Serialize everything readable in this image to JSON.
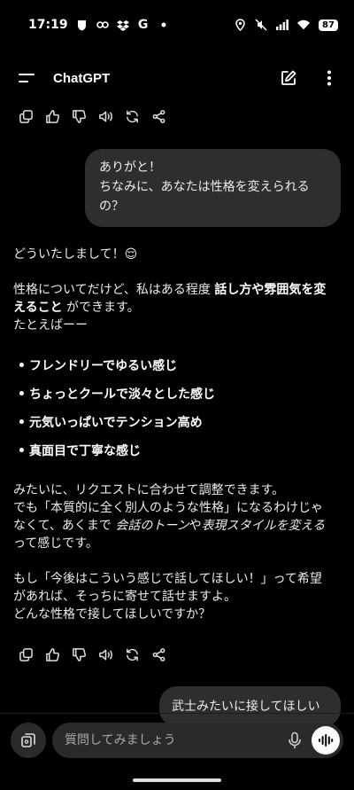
{
  "status_bar": {
    "time": "17:19",
    "battery": "87",
    "icons": [
      "shield-icon",
      "link-icon",
      "dropbox-icon",
      "google-g-icon",
      "dot-icon",
      "location-icon",
      "mute-icon",
      "signal-icon",
      "wifi-icon",
      "battery-icon"
    ],
    "g_label": "G"
  },
  "header": {
    "title": "ChatGPT",
    "icons": [
      "menu-icon",
      "new-chat-icon",
      "more-vert-icon"
    ]
  },
  "action_icons": [
    "copy-icon",
    "thumbs-up-icon",
    "thumbs-down-icon",
    "read-aloud-icon",
    "regenerate-icon",
    "share-icon"
  ],
  "user_message_1": {
    "line1": "ありがと！",
    "line2": "ちなみに、あなたは性格を変えられる",
    "line3": "の？"
  },
  "assistant_message": {
    "greeting": "どういたしまして！😌",
    "p1_pre": "性格についてだけど、私はある程度 ",
    "p1_bold1": "話し方や雰囲気を変",
    "p1_bold2": "えること",
    "p1_post": " ができます。",
    "p1_line3": "たとえばーー",
    "bullets": [
      "フレンドリーでゆるい感じ",
      "ちょっとクールで淡々とした感じ",
      "元気いっぱいでテンション高め",
      "真面目で丁寧な感じ"
    ],
    "p2_line1": "みたいに、リクエストに合わせて調整できます。",
    "p2_line2": "でも「本質的に全く別人のような性格」になるわけじゃ",
    "p2_line3_pre": "なくて、あくまで ",
    "p2_line3_ital1": "会話のトーン",
    "p2_line3_mid": "や",
    "p2_line3_ital2": "表現スタイルを変える",
    "p2_line4": "って感じです。",
    "p3_line1": "もし「今後はこういう感じで話してほしい！」って希望",
    "p3_line2": "があれば、そっちに寄せて話せますよ。",
    "p3_line3": "どんな性格で接してほしいですか？"
  },
  "user_message_2": {
    "text": "武士みたいに接してほしい"
  },
  "composer": {
    "placeholder": "質問してみましょう",
    "icons": [
      "attach-icon",
      "mic-icon",
      "voice-mode-icon"
    ]
  },
  "colors": {
    "background": "#000000",
    "bubble": "#2e2e2e",
    "input": "#2a2a2a",
    "text": "#ececec"
  }
}
